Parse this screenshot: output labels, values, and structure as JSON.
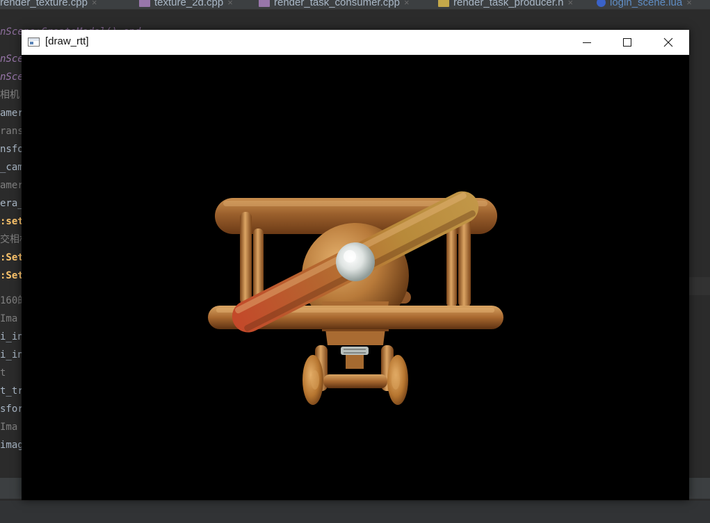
{
  "ide": {
    "tabs": [
      {
        "label": "render_texture.cpp",
        "type": "cpp",
        "active": false
      },
      {
        "label": "texture_2d.cpp",
        "type": "cpp",
        "active": false
      },
      {
        "label": "render_task_consumer.cpp",
        "type": "cpp",
        "active": false
      },
      {
        "label": "render_task_producer.h",
        "type": "h",
        "active": false
      },
      {
        "label": "login_scene.lua",
        "type": "lua",
        "active": true
      }
    ],
    "tab_close_glyph": "×",
    "code_lines": [
      {
        "text": "nSce",
        "style": "ital"
      },
      {
        "text": "nSce",
        "style": "ital"
      },
      {
        "text": "相机",
        "style": "gray"
      },
      {
        "text": "amer",
        "style": "white"
      },
      {
        "text": "ransf",
        "style": "gray"
      },
      {
        "text": "nsfo",
        "style": "white"
      },
      {
        "text": "_cam",
        "style": "white"
      },
      {
        "text": "amera",
        "style": "gray"
      },
      {
        "text": "era_",
        "style": "white"
      },
      {
        "text": ":set",
        "style": "yel"
      },
      {
        "text": "交相机",
        "style": "gray"
      },
      {
        "text": ":Set",
        "style": "yel"
      },
      {
        "text": ":Set",
        "style": "yel"
      },
      {
        "text": "160的",
        "style": "gray"
      },
      {
        "text": "Ima",
        "style": "gray"
      },
      {
        "text": "i_in",
        "style": "white"
      },
      {
        "text": "i_in",
        "style": "white"
      },
      {
        "text": "t",
        "style": "gray"
      },
      {
        "text": "t_tr",
        "style": "white"
      },
      {
        "text": "sfor",
        "style": "white"
      },
      {
        "text": "Ima",
        "style": "gray"
      },
      {
        "text": "imag",
        "style": "white"
      }
    ],
    "partial_top_line": "nScene:CreateModel() end"
  },
  "window": {
    "title": "[draw_rtt]",
    "buttons": {
      "minimize": "minimize",
      "maximize": "maximize",
      "close": "close"
    },
    "viewport_background": "#000000"
  },
  "colors": {
    "ide_bg": "#2b2b2b",
    "titlebar_bg": "#ffffff",
    "wood_light": "#d49a52",
    "wood_dark": "#8a5224",
    "propeller_tip": "#c9512e",
    "spinner": "#e8ecec"
  },
  "icons": {
    "app": "window-app-icon",
    "minimize": "minimize-icon",
    "maximize": "maximize-icon",
    "close": "close-icon"
  }
}
